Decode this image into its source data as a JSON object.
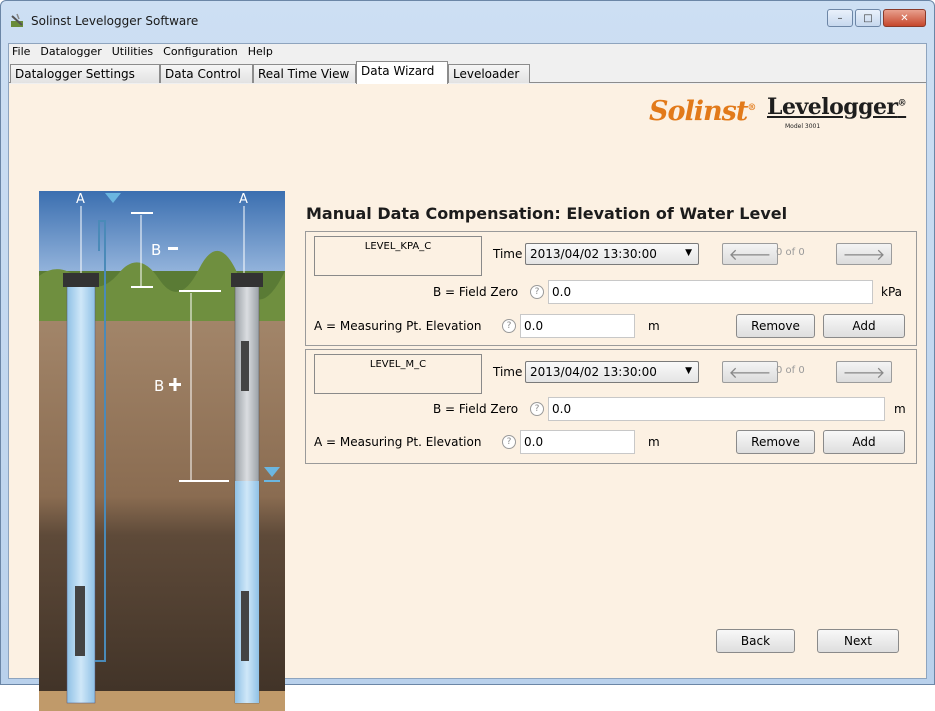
{
  "window": {
    "title": "Solinst Levelogger Software",
    "min": "–",
    "max": "□",
    "close": "✕"
  },
  "menu": [
    "File",
    "Datalogger",
    "Utilities",
    "Configuration",
    "Help"
  ],
  "tabs": [
    "Datalogger Settings",
    "Data Control",
    "Real Time View",
    "Data Wizard",
    "Leveloader"
  ],
  "active_tab": "Data Wizard",
  "logos": {
    "solinst": "Solinst",
    "levelogger": "Levelogger",
    "levelogger_model": "Model 3001"
  },
  "diagram": {
    "label_a": "A",
    "label_b_minus": "B",
    "label_b_plus": "B"
  },
  "heading": "Manual Data Compensation: Elevation of Water Level",
  "panels": [
    {
      "name": "LEVEL_KPA_C",
      "time_label": "Time",
      "time_value": "2013/04/02 13:30:00",
      "nav_count": "0 of 0",
      "field_zero_label": "B = Field Zero",
      "field_zero_value": "0.0",
      "field_zero_unit": "kPa",
      "mp_elev_label": "A = Measuring Pt. Elevation",
      "mp_elev_value": "0.0",
      "mp_elev_unit": "m",
      "remove_label": "Remove",
      "add_label": "Add"
    },
    {
      "name": "LEVEL_M_C",
      "time_label": "Time",
      "time_value": "2013/04/02 13:30:00",
      "nav_count": "0 of 0",
      "field_zero_label": "B = Field Zero",
      "field_zero_value": "0.0",
      "field_zero_unit": "m",
      "mp_elev_label": "A = Measuring Pt. Elevation",
      "mp_elev_value": "0.0",
      "mp_elev_unit": "m",
      "remove_label": "Remove",
      "add_label": "Add"
    }
  ],
  "footer": {
    "back_label": "Back",
    "next_label": "Next"
  },
  "help_glyph": "?",
  "arrow_left": "🡐",
  "arrow_right": "🡒",
  "combo_arrow": "▼"
}
